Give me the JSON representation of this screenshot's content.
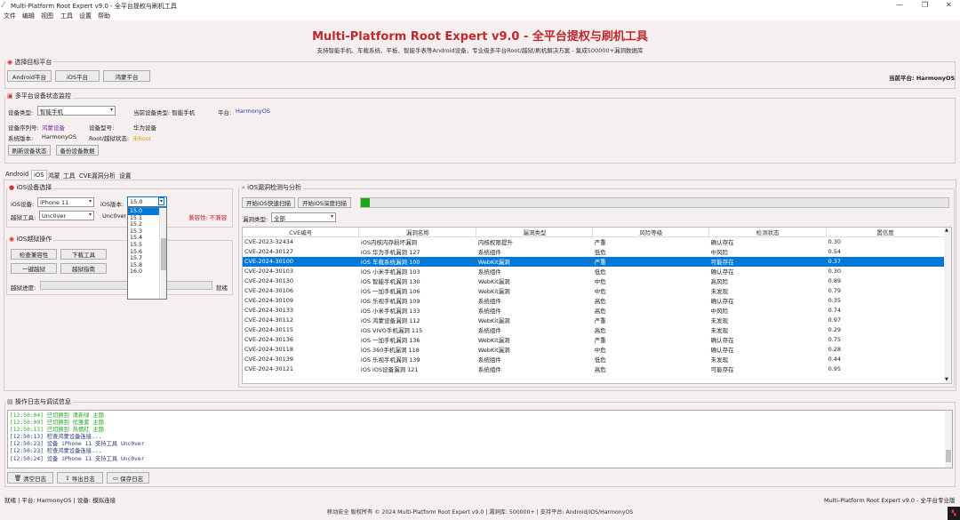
{
  "window": {
    "title": "Multi-Platform Root Expert v9.0 - 全平台提权与刷机工具",
    "controls": [
      "—",
      "❐",
      "✕"
    ]
  },
  "menu": [
    "文件",
    "编辑",
    "视图",
    "工具",
    "设置",
    "帮助"
  ],
  "header": {
    "title": "Multi-Platform Root Expert v9.0 - 全平台提权与刷机工具",
    "subtitle": "支持智能手机、车载系统、平板、智能手表等Android设备，专业级多平台Root/越狱/刷机解决方案 - 集成500000+漏洞数据库"
  },
  "platform_select": {
    "group_title": "选择目标平台",
    "buttons": [
      "Android平台",
      "iOS平台",
      "鸿蒙平台"
    ],
    "current": "当前平台: HarmonyOS"
  },
  "monitor": {
    "group_title": "多平台设备状态监控",
    "device_type_label": "设备类型:",
    "device_type_value": "智能手机",
    "current_type_label": "当前设备类型: 智能手机",
    "platform_label": "平台:",
    "platform_value": "HarmonyOS",
    "serial_label": "设备序列号:",
    "serial_value": "鸿蒙设备",
    "model_label": "设备型号:",
    "model_value": "华为设备",
    "sysver_label": "系统版本:",
    "sysver_value": "HarmonyOS",
    "root_label": "Root/越狱状态:",
    "root_value": "未Root",
    "buttons": [
      "刷新设备状态",
      "备份设备数据"
    ]
  },
  "tabs": [
    "Android",
    "iOS",
    "鸿蒙",
    "工具",
    "CVE漏洞分析",
    "设置"
  ],
  "ios_device": {
    "group_title": "iOS设备选择",
    "device_label": "iOS设备:",
    "device_value": "iPhone 11",
    "version_label": "iOS版本:",
    "version_value": "15.0",
    "tool_label": "越狱工具:",
    "tool_value": "Unc0ver",
    "tool_trunc": "Unc0ver",
    "compat": "兼容性: 不兼容",
    "version_options": [
      "15.0",
      "15.1",
      "15.2",
      "15.3",
      "15.4",
      "15.5",
      "15.6",
      "15.7",
      "15.8",
      "16.0"
    ]
  },
  "ios_jb": {
    "group_title": "iOS越狱操作",
    "buttons": [
      "检查兼容性",
      "下载工具",
      "一键越狱",
      "越狱指南"
    ],
    "progress_label": "越狱进度:",
    "progress_status": "就绪"
  },
  "vuln": {
    "group_title": "iOS漏洞检测与分析",
    "btn_quick": "开始iOS快速扫描",
    "btn_deep": "开始iOS深度扫描",
    "progress": 0.015,
    "type_label": "漏洞类型:",
    "type_value": "全部",
    "columns": [
      "CVE编号",
      "漏洞名称",
      "漏洞类型",
      "风险等级",
      "检测状态",
      "置信度"
    ],
    "rows": [
      [
        "CVE-2023-32434",
        "iOS内核内存损坏漏洞",
        "内核权限提升",
        "严重",
        "确认存在",
        "0.30"
      ],
      [
        "CVE-2024-30127",
        "iOS 华为手机漏洞 127",
        "系统组件",
        "低危",
        "中风险",
        "0.54"
      ],
      [
        "CVE-2024-30100",
        "iOS 车载系统漏洞 100",
        "WebKit漏洞",
        "严重",
        "可能存在",
        "0.37"
      ],
      [
        "CVE-2024-30103",
        "iOS 小米手机漏洞 103",
        "系统组件",
        "低危",
        "确认存在",
        "0.30"
      ],
      [
        "CVE-2024-30130",
        "iOS 智能手机漏洞 130",
        "WebKit漏洞",
        "中危",
        "高风险",
        "0.89"
      ],
      [
        "CVE-2024-30106",
        "iOS 一加手机漏洞 106",
        "WebKit漏洞",
        "中危",
        "未发现",
        "0.79"
      ],
      [
        "CVE-2024-30109",
        "iOS 乐视手机漏洞 109",
        "系统组件",
        "高危",
        "确认存在",
        "0.35"
      ],
      [
        "CVE-2024-30133",
        "iOS 小米手机漏洞 133",
        "系统组件",
        "高危",
        "中风险",
        "0.74"
      ],
      [
        "CVE-2024-30112",
        "iOS 鸿蒙设备漏洞 112",
        "WebKit漏洞",
        "严重",
        "未发现",
        "0.97"
      ],
      [
        "CVE-2024-30115",
        "iOS VIVO手机漏洞 115",
        "系统组件",
        "高危",
        "未发现",
        "0.29"
      ],
      [
        "CVE-2024-30136",
        "iOS 一加手机漏洞 136",
        "WebKit漏洞",
        "严重",
        "确认存在",
        "0.75"
      ],
      [
        "CVE-2024-30118",
        "iOS 360手机漏洞 118",
        "WebKit漏洞",
        "中危",
        "确认存在",
        "0.28"
      ],
      [
        "CVE-2024-30139",
        "iOS 乐视手机漏洞 139",
        "系统组件",
        "低危",
        "未发现",
        "0.44"
      ],
      [
        "CVE-2024-30121",
        "iOS iOS设备漏洞 121",
        "系统组件",
        "高危",
        "可能存在",
        "0.95"
      ]
    ],
    "selected_row": 2
  },
  "log": {
    "group_title": "操作日志与调试信息",
    "lines": [
      "[12:50:04] 已切换到 清新绿 主题",
      "[12:50:09] 已切换到 优雅紫 主题",
      "[12:50:13] 已切换到 热情红 主题",
      "[12:50:13] 检查鸿蒙设备连接...",
      "[12:50:23] 设备 iPhone 11 支持工具 Unc0ver",
      "[12:50:23] 检查鸿蒙设备连接...",
      "[12:50:24] 设备 iPhone 11 支持工具 Unc0ver"
    ],
    "buttons": [
      "清空日志",
      "导出日志",
      "保存日志"
    ]
  },
  "status": {
    "left": "就绪 | 平台: HarmonyOS | 设备: 模拟连接",
    "right": "Multi-Platform Root Expert v9.0 - 全平台专业版",
    "footer": "移动安全 版权所有 © 2024 Multi-Platform Root Expert v9.0 | 漏洞库: 500000+ | 支持平台: Android/iOS/HarmonyOS"
  },
  "colors": {
    "accent": "#0078d7",
    "title_red": "#c0282c",
    "progress_green": "#1aa81a"
  }
}
